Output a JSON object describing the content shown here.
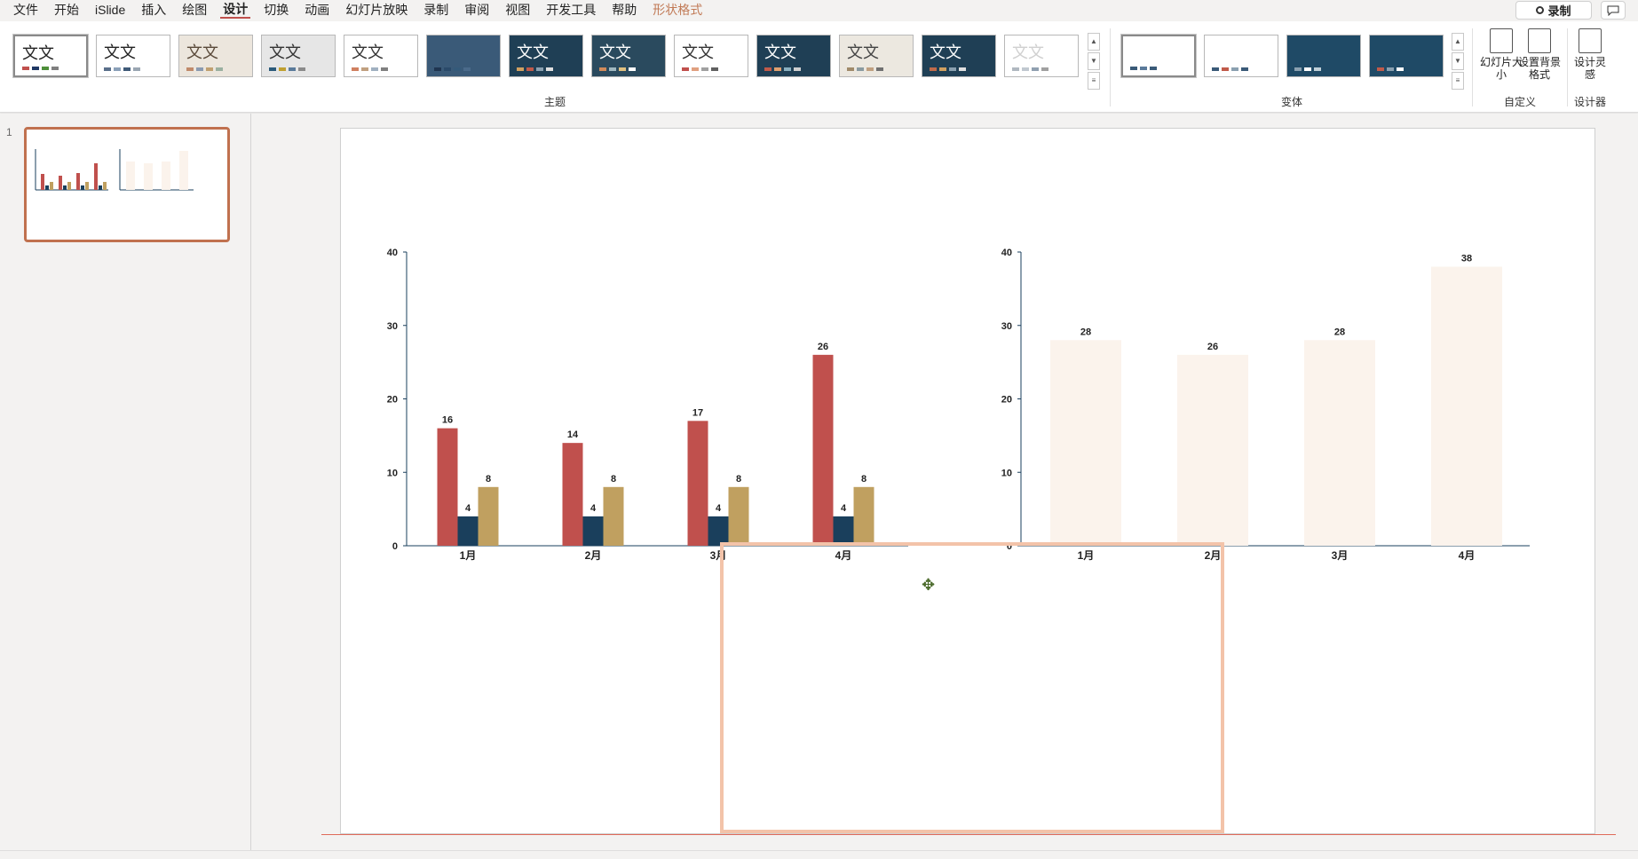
{
  "menu": {
    "items": [
      "文件",
      "开始",
      "iSlide",
      "插入",
      "绘图",
      "设计",
      "切换",
      "动画",
      "幻灯片放映",
      "录制",
      "审阅",
      "视图",
      "开发工具",
      "帮助",
      "形状格式"
    ],
    "active_index": 5,
    "context_index": 14,
    "record_label": "录制"
  },
  "ribbon": {
    "theme_group_label": "主题",
    "variant_group_label": "变体",
    "customize_group_label": "自定义",
    "designer_group_label": "设计器",
    "slide_size_label": "幻灯片大小",
    "format_bg_label": "设置背景格式",
    "design_ideas_label": "设计灵感",
    "themes": [
      {
        "label": "文文",
        "bg": "#ffffff",
        "fg": "#222222",
        "bars": [
          "#c0504d",
          "#1f3864",
          "#4e8f3a",
          "#7f7f7f"
        ]
      },
      {
        "label": "文文",
        "bg": "#ffffff",
        "fg": "#222222",
        "bars": [
          "#5a6f8a",
          "#8aa0b8",
          "#3f5a78",
          "#9aa6b2"
        ]
      },
      {
        "label": "文文",
        "bg": "#ece6dd",
        "fg": "#5a4a3a",
        "bars": [
          "#c08a6a",
          "#8a9ab0",
          "#c0a070",
          "#9ab0a0"
        ]
      },
      {
        "label": "文文",
        "bg": "#e6e6e6",
        "fg": "#333333",
        "bars": [
          "#2a5a7a",
          "#c0a030",
          "#5a7a9a",
          "#8a8a8a"
        ]
      },
      {
        "label": "文文",
        "bg": "#ffffff",
        "fg": "#333333",
        "bars": [
          "#d08060",
          "#c0a080",
          "#a0b0c0",
          "#808080"
        ]
      },
      {
        "label": "",
        "bg": "#3a5a78",
        "fg": "#ffffff",
        "bars": [
          "#1f3550",
          "#2a4a6a",
          "#345a7a",
          "#4a6a8a"
        ]
      },
      {
        "label": "文文",
        "bg": "#1f3f55",
        "fg": "#ffffff",
        "bars": [
          "#d0a060",
          "#c05a4a",
          "#8aa0b0",
          "#e0e0e0"
        ]
      },
      {
        "label": "文文",
        "bg": "#2a4a5e",
        "fg": "#ffffff",
        "bars": [
          "#d08a5a",
          "#a0b8c0",
          "#e0c080",
          "#ffffff"
        ]
      },
      {
        "label": "文文",
        "bg": "#ffffff",
        "fg": "#333333",
        "bars": [
          "#c0504d",
          "#e0a080",
          "#a0a0a0",
          "#606060"
        ]
      },
      {
        "label": "文文",
        "bg": "#1f3f55",
        "fg": "#ffffff",
        "bars": [
          "#c05a4a",
          "#e0a070",
          "#8ab0c0",
          "#d0d0d0"
        ]
      },
      {
        "label": "文文",
        "bg": "#ece8e0",
        "fg": "#444444",
        "bars": [
          "#a08a6a",
          "#8a9aa0",
          "#c0a080",
          "#707070"
        ]
      },
      {
        "label": "文文",
        "bg": "#1f3f55",
        "fg": "#ffffff",
        "bars": [
          "#c06a4a",
          "#d0a060",
          "#8aa0b0",
          "#e0e0e0"
        ]
      },
      {
        "label": "文文",
        "bg": "#ffffff",
        "fg": "#d0d0d0",
        "bars": [
          "#b0b8c0",
          "#c0c8d0",
          "#90a0b0",
          "#a0a0a0"
        ]
      }
    ],
    "variants": [
      {
        "bg": "#ffffff",
        "bars": [
          "#3a5a78",
          "#5a7a9a",
          "#3a5a78"
        ]
      },
      {
        "bg": "#ffffff",
        "bars": [
          "#3a5a78",
          "#c05a4a",
          "#8aa0b0",
          "#3a5a78"
        ]
      },
      {
        "bg": "#1f4a66",
        "bars": [
          "#8aa0b0",
          "#ffffff",
          "#c0d0d8"
        ]
      },
      {
        "bg": "#1f4a66",
        "bars": [
          "#c05a4a",
          "#8aa0b0",
          "#ffffff"
        ]
      }
    ]
  },
  "slides_panel": {
    "slide_number": "1"
  },
  "chart_data": [
    {
      "type": "bar",
      "categories": [
        "1月",
        "2月",
        "3月",
        "4月"
      ],
      "series": [
        {
          "values": [
            16,
            14,
            17,
            26
          ],
          "color": "#c0504d"
        },
        {
          "values": [
            4,
            4,
            4,
            4
          ],
          "color": "#1a3f5c"
        },
        {
          "values": [
            8,
            8,
            8,
            8
          ],
          "color": "#c0a060"
        }
      ],
      "ylim": [
        0,
        40
      ],
      "yticks": [
        0,
        10,
        20,
        30,
        40
      ],
      "data_labels": true
    },
    {
      "type": "bar",
      "categories": [
        "1月",
        "2月",
        "3月",
        "4月"
      ],
      "series": [
        {
          "values": [
            28,
            26,
            28,
            38
          ],
          "color": "#fbf3ec"
        }
      ],
      "ylim": [
        0,
        40
      ],
      "yticks": [
        0,
        10,
        20,
        30,
        40
      ],
      "data_labels": true
    }
  ]
}
